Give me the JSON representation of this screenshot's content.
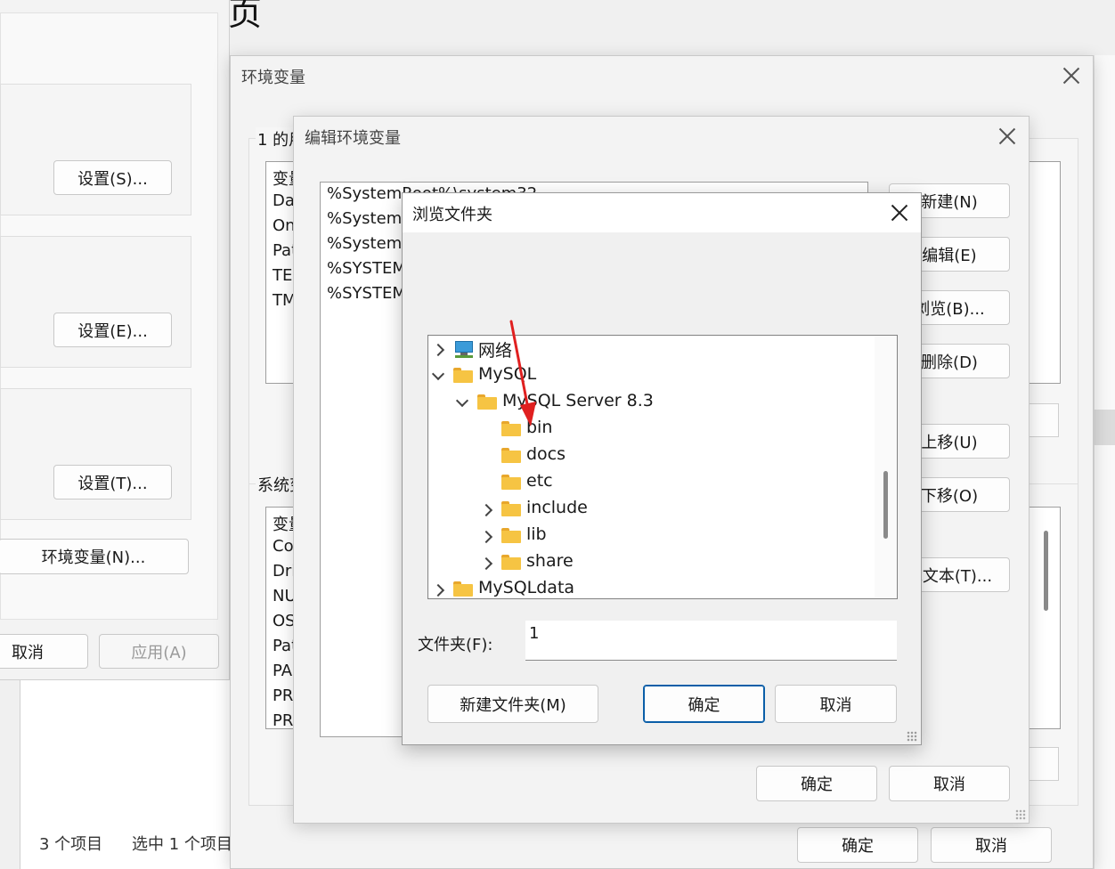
{
  "bg_window": {
    "title_fragment": "页",
    "buttons": {
      "settings_s": "设置(S)...",
      "settings_e": "设置(E)...",
      "settings_t": "设置(T)...",
      "env_vars": "环境变量(N)...",
      "cancel": "取消",
      "apply": "应用(A)"
    }
  },
  "explorer_status": {
    "items": "3 个项目",
    "selected": "选中 1 个项目"
  },
  "env_window": {
    "title": "环境变量",
    "user_section_label": "1 的用",
    "user_vars_header": "变量",
    "user_vars": [
      "Da",
      "On",
      "Pat",
      "TEI",
      "TM"
    ],
    "system_section_label": "系统变",
    "system_vars_header": "变量",
    "system_vars": [
      "Co",
      "Dri",
      "NU",
      "OS",
      "Pat",
      "PA",
      "PR",
      "PR"
    ],
    "ok": "确定",
    "cancel": "取消"
  },
  "edit_window": {
    "title": "编辑环境变量",
    "paths": [
      "%SystemRoot%\\system32",
      "%SystemR",
      "%SystemR",
      "%SYSTEM",
      "%SYSTEM"
    ],
    "buttons": {
      "new": "新建(N)",
      "edit": "编辑(E)",
      "browse": "浏览(B)...",
      "delete": "删除(D)",
      "move_up": "上移(U)",
      "move_down": "下移(O)",
      "edit_text": "辑文本(T)..."
    },
    "ok": "确定",
    "cancel": "取消"
  },
  "browse_dialog": {
    "title": "浏览文件夹",
    "tree": [
      {
        "label": "网络",
        "depth": 0,
        "expander": "collapsed",
        "icon": "network-icon"
      },
      {
        "label": "MySQL",
        "depth": 0,
        "expander": "expanded",
        "icon": "folder-icon"
      },
      {
        "label": "MySQL Server 8.3",
        "depth": 1,
        "expander": "expanded",
        "icon": "folder-icon"
      },
      {
        "label": "bin",
        "depth": 2,
        "expander": "none",
        "icon": "folder-icon"
      },
      {
        "label": "docs",
        "depth": 2,
        "expander": "none",
        "icon": "folder-icon"
      },
      {
        "label": "etc",
        "depth": 2,
        "expander": "none",
        "icon": "folder-icon"
      },
      {
        "label": "include",
        "depth": 2,
        "expander": "collapsed",
        "icon": "folder-icon"
      },
      {
        "label": "lib",
        "depth": 2,
        "expander": "collapsed",
        "icon": "folder-icon"
      },
      {
        "label": "share",
        "depth": 2,
        "expander": "collapsed",
        "icon": "folder-icon"
      },
      {
        "label": "MySQLdata",
        "depth": 0,
        "expander": "collapsed",
        "icon": "folder-icon"
      }
    ],
    "folder_label": "文件夹(F):",
    "folder_value": "1",
    "new_folder": "新建文件夹(M)",
    "ok": "确定",
    "cancel": "取消"
  },
  "colors": {
    "annotation_arrow": "#e02020",
    "folder": "#f6c443",
    "primary_border": "#0a5ea8"
  }
}
